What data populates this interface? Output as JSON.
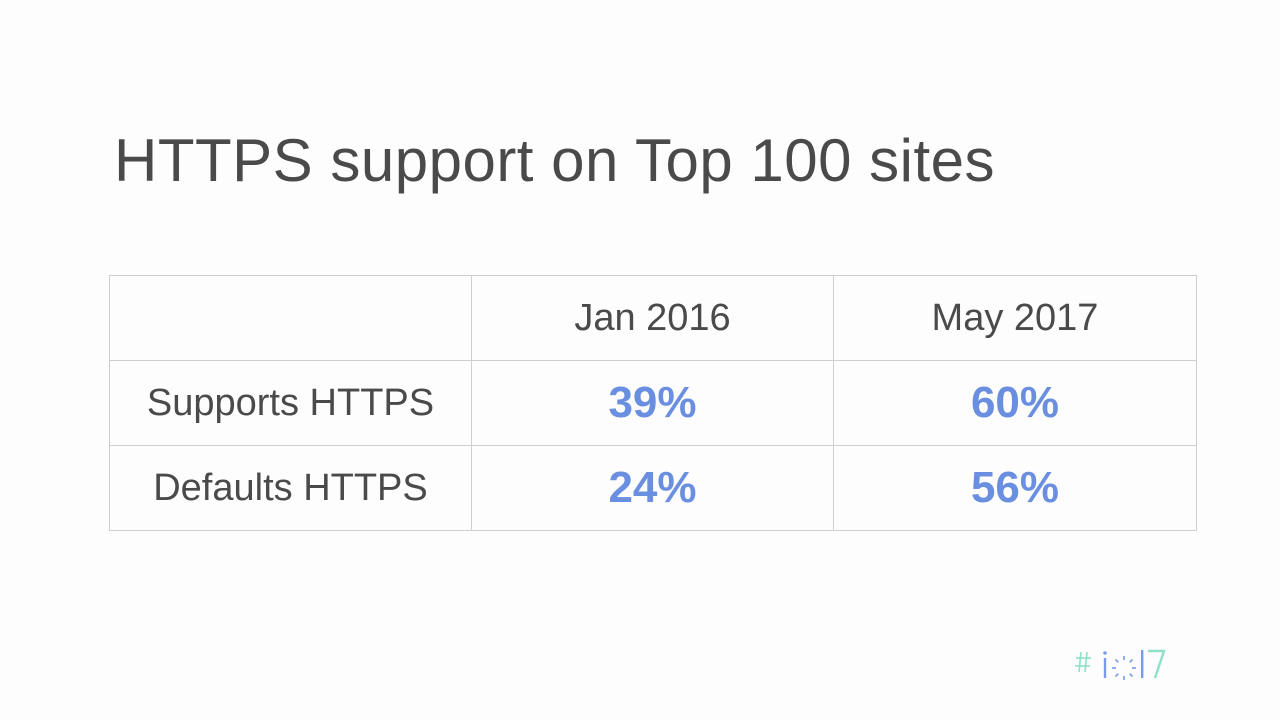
{
  "slide": {
    "title": "HTTPS support on Top 100 sites"
  },
  "table": {
    "headers": [
      "",
      "Jan 2016",
      "May 2017"
    ],
    "rows": [
      {
        "label": "Supports HTTPS",
        "values": [
          "39%",
          "60%"
        ]
      },
      {
        "label": "Defaults HTTPS",
        "values": [
          "24%",
          "56%"
        ]
      }
    ]
  },
  "logo": {
    "text": "#io17",
    "icon": "google-io-17-logo"
  },
  "colors": {
    "accent": "#6a8fe0",
    "text": "#4a4a4a",
    "border": "#cfcfcf",
    "background": "#fdfdfd"
  }
}
